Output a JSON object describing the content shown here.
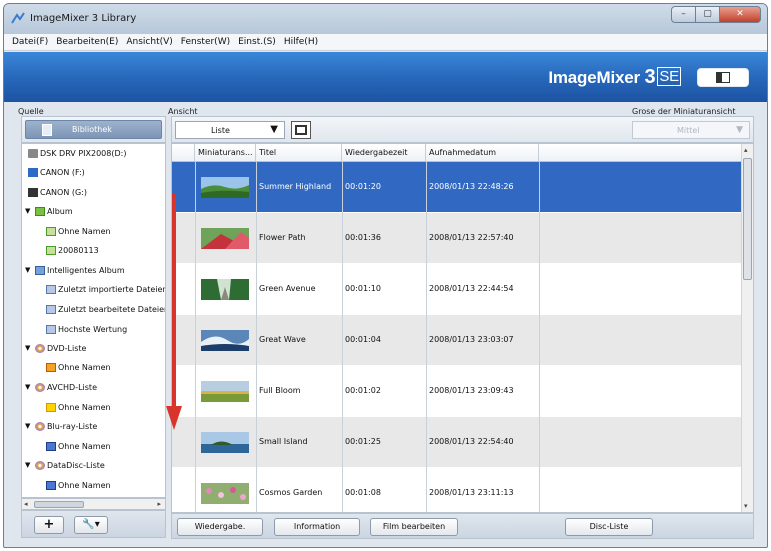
{
  "window": {
    "title": "ImageMixer 3 Library",
    "minimize": "–",
    "maximize": "▢",
    "close": "✕"
  },
  "menu": [
    "Datei(F)",
    "Bearbeiten(E)",
    "Ansicht(V)",
    "Fenster(W)",
    "Einst.(S)",
    "Hilfe(H)"
  ],
  "brand": {
    "name": "ImageMixer ",
    "version": "3",
    "edition": "SE"
  },
  "labels": {
    "source": "Quelle",
    "view": "Ansicht",
    "thumb_size": "Grose der Miniaturansicht"
  },
  "library_button": "Bibliothek",
  "tree": [
    {
      "label": "DSK DRV PIX2008(D:)",
      "icon": "drive-icon",
      "level": 1
    },
    {
      "label": "CANON (F:)",
      "icon": "sd-card-icon",
      "level": 1
    },
    {
      "label": "CANON (G:)",
      "icon": "camera-icon",
      "level": 1
    },
    {
      "label": "Album",
      "icon": "album-icon",
      "level": 0,
      "expanded": true
    },
    {
      "label": "Ohne Namen",
      "icon": "photo-icon",
      "level": 2
    },
    {
      "label": "20080113",
      "icon": "photo-icon",
      "level": 2
    },
    {
      "label": "Intelligentes Album",
      "icon": "smart-album-icon",
      "level": 0,
      "expanded": true
    },
    {
      "label": "Zuletzt importierte Dateien",
      "icon": "document-icon",
      "level": 2
    },
    {
      "label": "Zuletzt bearbeitete Dateien",
      "icon": "document-icon",
      "level": 2
    },
    {
      "label": "Hochste Wertung",
      "icon": "document-icon",
      "level": 2
    },
    {
      "label": "DVD-Liste",
      "icon": "disc-icon",
      "level": 0,
      "expanded": true
    },
    {
      "label": "Ohne Namen",
      "icon": "dvd-icon",
      "level": 2
    },
    {
      "label": "AVCHD-Liste",
      "icon": "disc-icon",
      "level": 0,
      "expanded": true
    },
    {
      "label": "Ohne Namen",
      "icon": "avchd-icon",
      "level": 2
    },
    {
      "label": "Blu-ray-Liste",
      "icon": "disc-icon",
      "level": 0,
      "expanded": true
    },
    {
      "label": "Ohne Namen",
      "icon": "bluray-icon",
      "level": 2
    },
    {
      "label": "DataDisc-Liste",
      "icon": "disc-icon",
      "level": 0,
      "expanded": true
    },
    {
      "label": "Ohne Namen",
      "icon": "bluray-icon",
      "level": 2
    }
  ],
  "left_buttons": {
    "add": "+",
    "tools": "🔧▾"
  },
  "view_select": {
    "value": "Liste",
    "arrow": "▼"
  },
  "size_select": {
    "value": "Mittel",
    "arrow": "▼"
  },
  "columns": [
    "Miniaturans...",
    "Titel",
    "Wiedergabezeit",
    "Aufnahmedatum"
  ],
  "rows": [
    {
      "title": "Summer Highland",
      "duration": "00:01:20",
      "date": "2008/01/13 22:48:26",
      "thumb": "meadow",
      "selected": true
    },
    {
      "title": "Flower Path",
      "duration": "00:01:36",
      "date": "2008/01/13 22:57:40",
      "thumb": "flowers"
    },
    {
      "title": "Green Avenue",
      "duration": "00:01:10",
      "date": "2008/01/13 22:44:54",
      "thumb": "trees"
    },
    {
      "title": "Great Wave",
      "duration": "00:01:04",
      "date": "2008/01/13 23:03:07",
      "thumb": "wave"
    },
    {
      "title": "Full Bloom",
      "duration": "00:01:02",
      "date": "2008/01/13 23:09:43",
      "thumb": "field"
    },
    {
      "title": "Small Island",
      "duration": "00:01:25",
      "date": "2008/01/13 22:54:40",
      "thumb": "island"
    },
    {
      "title": "Cosmos Garden",
      "duration": "00:01:08",
      "date": "2008/01/13 23:11:13",
      "thumb": "cosmos"
    }
  ],
  "bottom_buttons": [
    "Wiedergabe.",
    "Information",
    "Film bearbeiten",
    "Disc-Liste"
  ],
  "colors": {
    "selection": "#3169c2",
    "banner": "#2666b9",
    "annotation_arrow": "#d9342b"
  }
}
